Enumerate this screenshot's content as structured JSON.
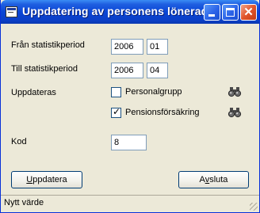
{
  "window": {
    "title": "Uppdatering av personens lönerader"
  },
  "form": {
    "from_period_label": "Från statistikperiod",
    "from_year": "2006",
    "from_month": "01",
    "to_period_label": "Till statistikperiod",
    "to_year": "2006",
    "to_month": "04",
    "update_label": "Uppdateras",
    "options": [
      {
        "label": "Personalgrupp",
        "checked": false
      },
      {
        "label": "Pensionsförsäkring",
        "checked": true
      }
    ],
    "code_label": "Kod",
    "code_value": "8"
  },
  "buttons": {
    "update_prefix": "",
    "update_underlined": "U",
    "update_rest": "ppdatera",
    "close_prefix": "A",
    "close_underlined": "v",
    "close_rest": "sluta"
  },
  "status": {
    "text": "Nytt värde"
  }
}
